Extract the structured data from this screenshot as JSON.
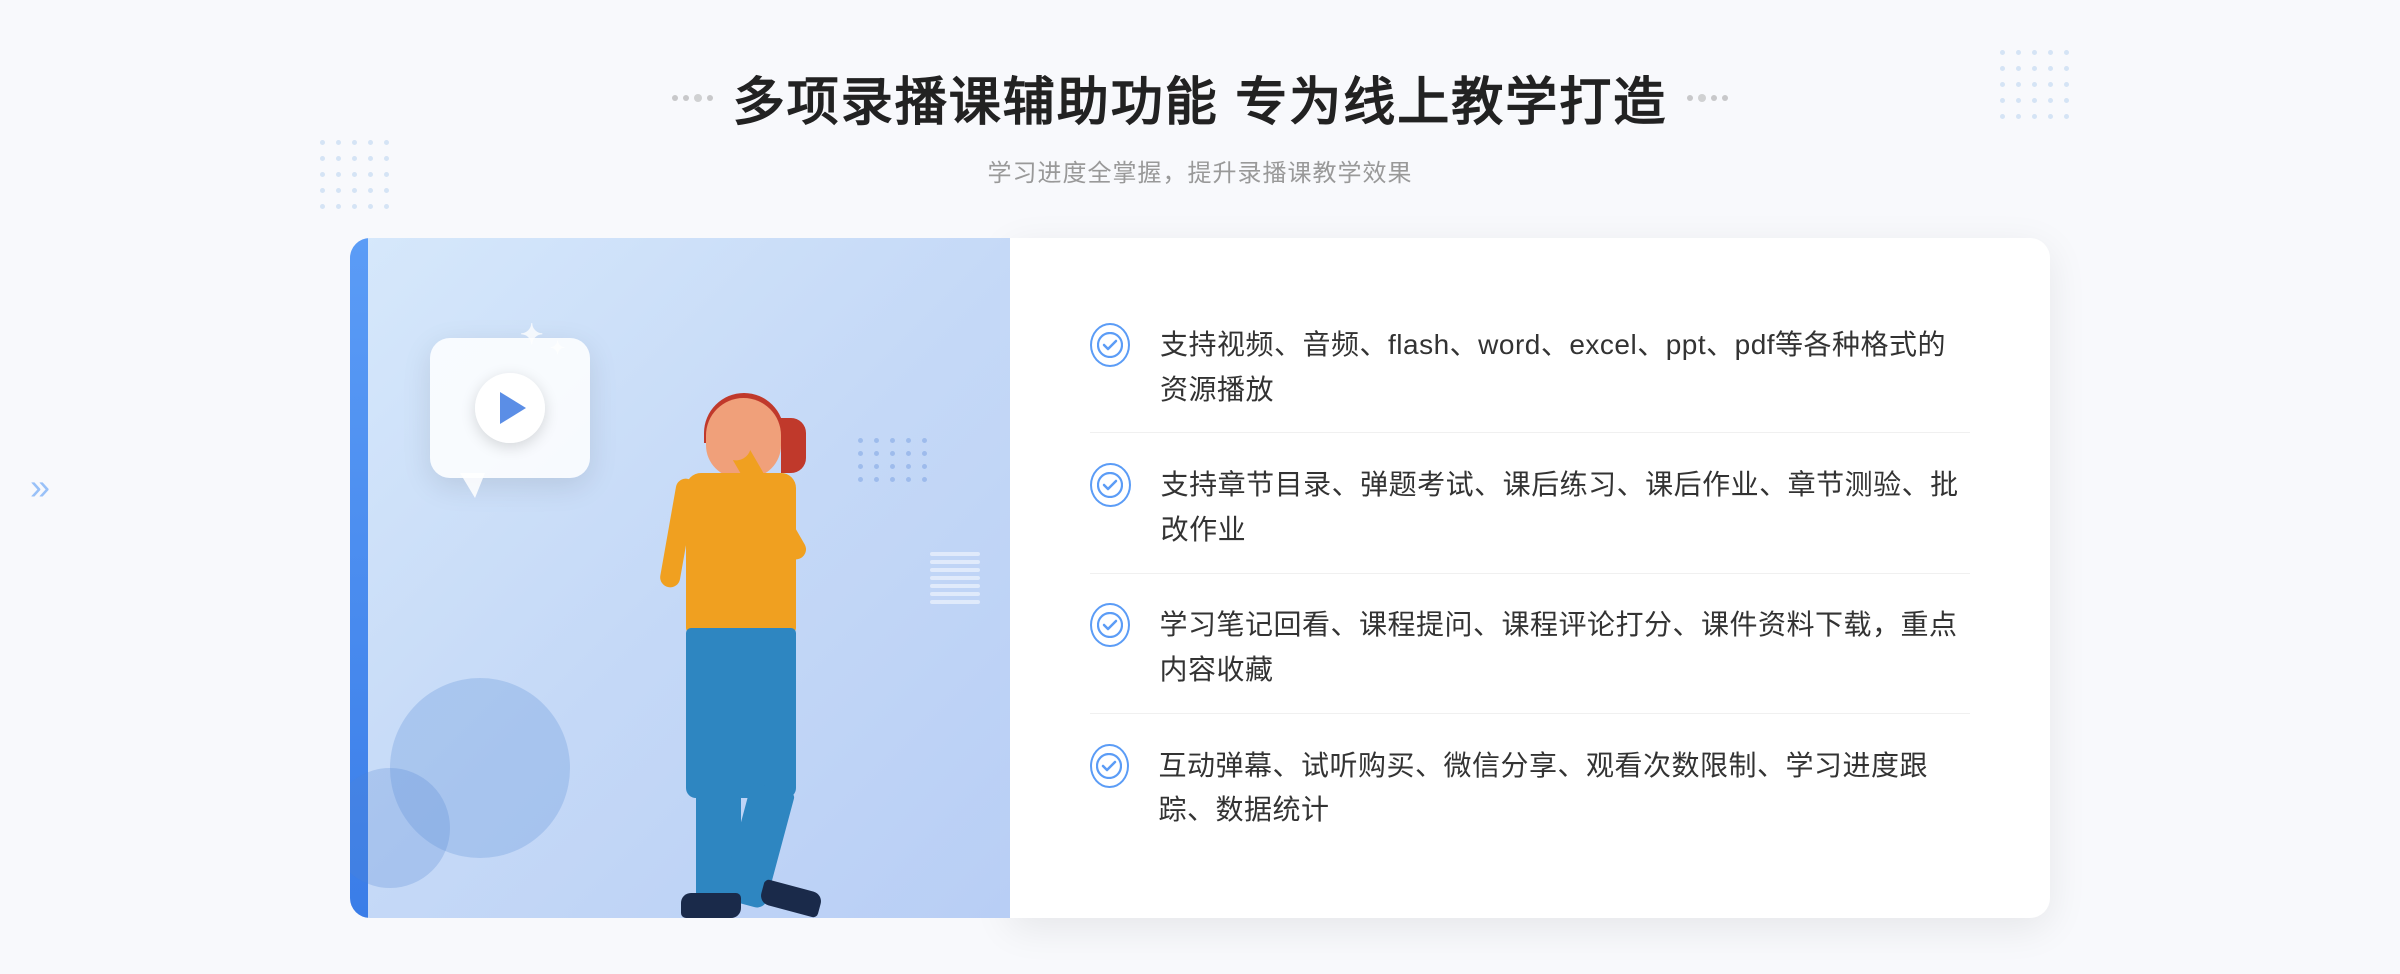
{
  "page": {
    "background": "#f5f7fc"
  },
  "header": {
    "title": "多项录播课辅助功能 专为线上教学打造",
    "subtitle": "学习进度全掌握，提升录播课教学效果"
  },
  "decorators": {
    "left_dots_label": "decorative-dots-left",
    "right_dots_label": "decorative-dots-right"
  },
  "features": [
    {
      "id": 1,
      "text": "支持视频、音频、flash、word、excel、ppt、pdf等各种格式的资源播放"
    },
    {
      "id": 2,
      "text": "支持章节目录、弹题考试、课后练习、课后作业、章节测验、批改作业"
    },
    {
      "id": 3,
      "text": "学习笔记回看、课程提问、课程评论打分、课件资料下载，重点内容收藏"
    },
    {
      "id": 4,
      "text": "互动弹幕、试听购买、微信分享、观看次数限制、学习进度跟踪、数据统计"
    }
  ]
}
